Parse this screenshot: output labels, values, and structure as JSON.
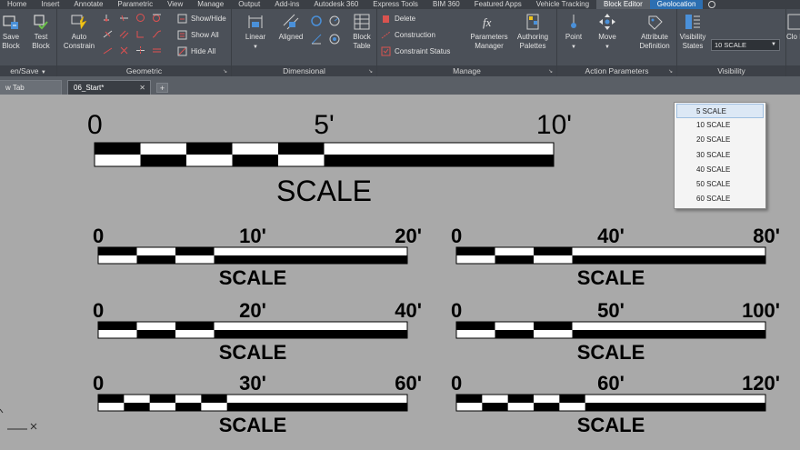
{
  "menu_tabs": [
    {
      "label": "Home",
      "active": false
    },
    {
      "label": "Insert",
      "active": false
    },
    {
      "label": "Annotate",
      "active": false
    },
    {
      "label": "Parametric",
      "active": false
    },
    {
      "label": "View",
      "active": false
    },
    {
      "label": "Manage",
      "active": false
    },
    {
      "label": "Output",
      "active": false
    },
    {
      "label": "Add-ins",
      "active": false
    },
    {
      "label": "Autodesk 360",
      "active": false
    },
    {
      "label": "Express Tools",
      "active": false
    },
    {
      "label": "BIM 360",
      "active": false
    },
    {
      "label": "Featured Apps",
      "active": false
    },
    {
      "label": "Vehicle Tracking",
      "active": false
    },
    {
      "label": "Block Editor",
      "active": true
    },
    {
      "label": "Geolocation",
      "active": false
    }
  ],
  "ribbon": {
    "open_save": {
      "title": "en/Save",
      "save_block": "Save Block",
      "test_block": "Test Block"
    },
    "geometric": {
      "title": "Geometric",
      "auto_constrain": "Auto Constrain",
      "show_hide": "Show/Hide",
      "show_all": "Show All",
      "hide_all": "Hide All"
    },
    "dimensional": {
      "title": "Dimensional",
      "linear": "Linear",
      "aligned": "Aligned"
    },
    "manage": {
      "title": "Manage",
      "block_table": "Block Table",
      "delete": "Delete",
      "construction": "Construction",
      "constraint_status": "Constraint Status",
      "parameters_manager": "Parameters Manager",
      "authoring_palettes": "Authoring Palettes"
    },
    "action_parameters": {
      "title": "Action Parameters",
      "point": "Point",
      "move": "Move",
      "attribute_definition": "Attribute Definition"
    },
    "visibility": {
      "title": "Visibility",
      "visibility_states": "Visibility States",
      "selected_state": "10 SCALE"
    },
    "close": {
      "label": "Clo Bloc"
    }
  },
  "file_tabs": [
    {
      "label": "w Tab",
      "active": false
    },
    {
      "label": "06_Start*",
      "active": true
    }
  ],
  "scale_dropdown": {
    "options": [
      "5 SCALE",
      "10 SCALE",
      "20 SCALE",
      "30 SCALE",
      "40 SCALE",
      "50 SCALE",
      "60 SCALE"
    ],
    "highlighted": "5 SCALE"
  },
  "drawing": {
    "main_scale": {
      "start": "0",
      "mid": "5'",
      "end": "10'",
      "title": "SCALE"
    },
    "scale_bars": [
      {
        "start": "0",
        "mid": "10'",
        "end": "20'",
        "title": "SCALE"
      },
      {
        "start": "0",
        "mid": "40'",
        "end": "80'",
        "title": "SCALE"
      },
      {
        "start": "0",
        "mid": "20'",
        "end": "40'",
        "title": "SCALE"
      },
      {
        "start": "0",
        "mid": "50'",
        "end": "100'",
        "title": "SCALE"
      },
      {
        "start": "0",
        "mid": "30'",
        "end": "60'",
        "title": "SCALE"
      },
      {
        "start": "0",
        "mid": "60'",
        "end": "120'",
        "title": "SCALE"
      }
    ]
  },
  "colors": {
    "canvas": "#a9a9a9",
    "ribbon": "#4b5058",
    "active_tab": "#5b6067",
    "geolocation_tab": "#2c6fb2",
    "bar_black": "#000000",
    "bar_white": "#ffffff"
  }
}
